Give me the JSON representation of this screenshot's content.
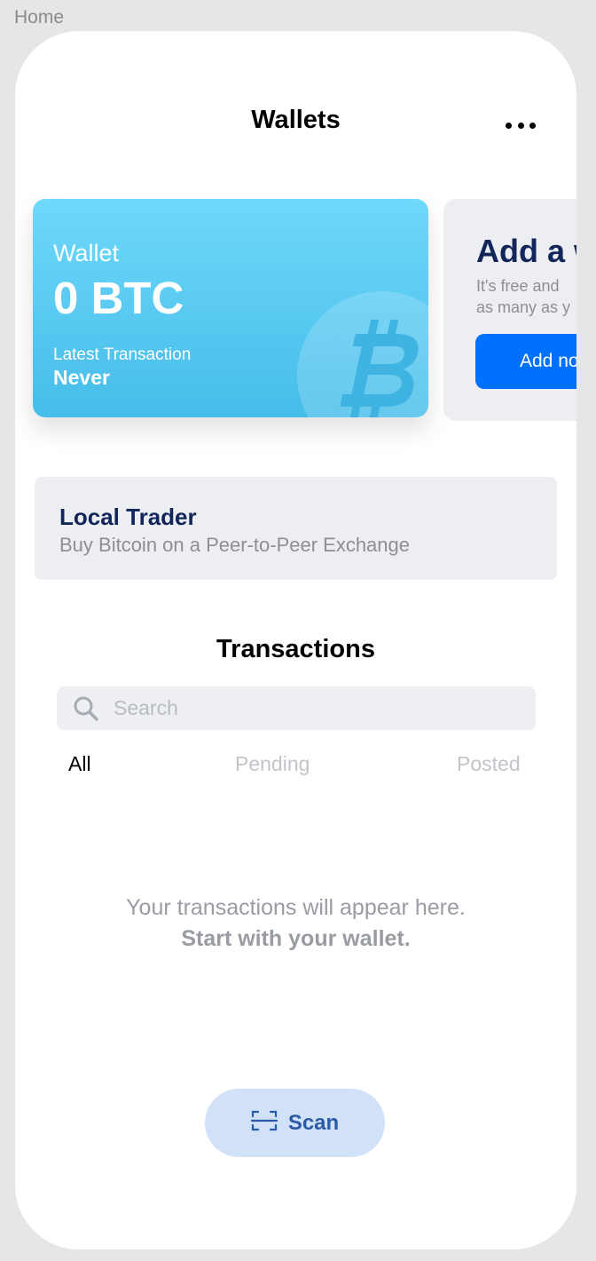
{
  "screen_label": "Home",
  "header": {
    "title": "Wallets",
    "more_icon": "ellipsis-icon"
  },
  "wallet_card": {
    "label": "Wallet",
    "balance": "0 BTC",
    "latest_label": "Latest Transaction",
    "latest_value": "Never",
    "icon": "bitcoin-icon",
    "gradient": [
      "#6fd8fb",
      "#45bde9"
    ]
  },
  "add_wallet_card": {
    "title": "Add a w",
    "subtitle": "It's free and\nas many as y",
    "button_label": "Add no"
  },
  "local_trader": {
    "title": "Local Trader",
    "subtitle": "Buy Bitcoin on a Peer-to-Peer Exchange"
  },
  "transactions": {
    "title": "Transactions",
    "search": {
      "placeholder": "Search",
      "value": "",
      "icon": "search-icon"
    },
    "filters": [
      "All",
      "Pending",
      "Posted"
    ],
    "active_filter": "All",
    "empty_line1": "Your transactions will appear here.",
    "empty_line2": "Start with your wallet."
  },
  "scan_button": {
    "label": "Scan",
    "icon": "scan-icon"
  },
  "colors": {
    "accent": "#0070ff",
    "navy": "#12265a",
    "scan_bg": "#d1e1f8",
    "scan_text": "#2b5aa6"
  }
}
